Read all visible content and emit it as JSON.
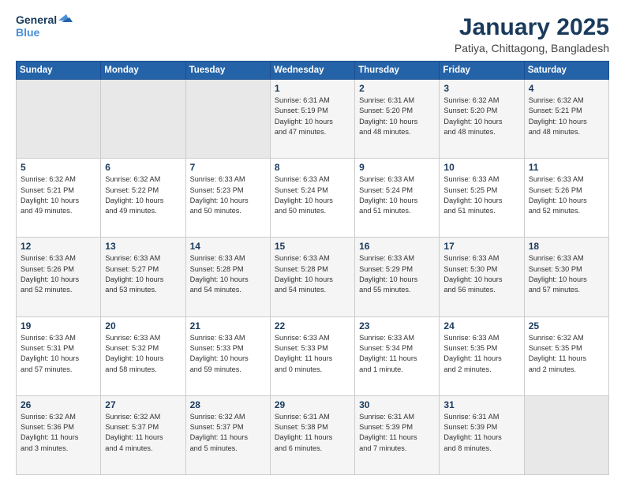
{
  "logo": {
    "line1": "General",
    "line2": "Blue"
  },
  "title": "January 2025",
  "subtitle": "Patiya, Chittagong, Bangladesh",
  "weekdays": [
    "Sunday",
    "Monday",
    "Tuesday",
    "Wednesday",
    "Thursday",
    "Friday",
    "Saturday"
  ],
  "weeks": [
    [
      {
        "day": "",
        "info": ""
      },
      {
        "day": "",
        "info": ""
      },
      {
        "day": "",
        "info": ""
      },
      {
        "day": "1",
        "info": "Sunrise: 6:31 AM\nSunset: 5:19 PM\nDaylight: 10 hours\nand 47 minutes."
      },
      {
        "day": "2",
        "info": "Sunrise: 6:31 AM\nSunset: 5:20 PM\nDaylight: 10 hours\nand 48 minutes."
      },
      {
        "day": "3",
        "info": "Sunrise: 6:32 AM\nSunset: 5:20 PM\nDaylight: 10 hours\nand 48 minutes."
      },
      {
        "day": "4",
        "info": "Sunrise: 6:32 AM\nSunset: 5:21 PM\nDaylight: 10 hours\nand 48 minutes."
      }
    ],
    [
      {
        "day": "5",
        "info": "Sunrise: 6:32 AM\nSunset: 5:21 PM\nDaylight: 10 hours\nand 49 minutes."
      },
      {
        "day": "6",
        "info": "Sunrise: 6:32 AM\nSunset: 5:22 PM\nDaylight: 10 hours\nand 49 minutes."
      },
      {
        "day": "7",
        "info": "Sunrise: 6:33 AM\nSunset: 5:23 PM\nDaylight: 10 hours\nand 50 minutes."
      },
      {
        "day": "8",
        "info": "Sunrise: 6:33 AM\nSunset: 5:24 PM\nDaylight: 10 hours\nand 50 minutes."
      },
      {
        "day": "9",
        "info": "Sunrise: 6:33 AM\nSunset: 5:24 PM\nDaylight: 10 hours\nand 51 minutes."
      },
      {
        "day": "10",
        "info": "Sunrise: 6:33 AM\nSunset: 5:25 PM\nDaylight: 10 hours\nand 51 minutes."
      },
      {
        "day": "11",
        "info": "Sunrise: 6:33 AM\nSunset: 5:26 PM\nDaylight: 10 hours\nand 52 minutes."
      }
    ],
    [
      {
        "day": "12",
        "info": "Sunrise: 6:33 AM\nSunset: 5:26 PM\nDaylight: 10 hours\nand 52 minutes."
      },
      {
        "day": "13",
        "info": "Sunrise: 6:33 AM\nSunset: 5:27 PM\nDaylight: 10 hours\nand 53 minutes."
      },
      {
        "day": "14",
        "info": "Sunrise: 6:33 AM\nSunset: 5:28 PM\nDaylight: 10 hours\nand 54 minutes."
      },
      {
        "day": "15",
        "info": "Sunrise: 6:33 AM\nSunset: 5:28 PM\nDaylight: 10 hours\nand 54 minutes."
      },
      {
        "day": "16",
        "info": "Sunrise: 6:33 AM\nSunset: 5:29 PM\nDaylight: 10 hours\nand 55 minutes."
      },
      {
        "day": "17",
        "info": "Sunrise: 6:33 AM\nSunset: 5:30 PM\nDaylight: 10 hours\nand 56 minutes."
      },
      {
        "day": "18",
        "info": "Sunrise: 6:33 AM\nSunset: 5:30 PM\nDaylight: 10 hours\nand 57 minutes."
      }
    ],
    [
      {
        "day": "19",
        "info": "Sunrise: 6:33 AM\nSunset: 5:31 PM\nDaylight: 10 hours\nand 57 minutes."
      },
      {
        "day": "20",
        "info": "Sunrise: 6:33 AM\nSunset: 5:32 PM\nDaylight: 10 hours\nand 58 minutes."
      },
      {
        "day": "21",
        "info": "Sunrise: 6:33 AM\nSunset: 5:33 PM\nDaylight: 10 hours\nand 59 minutes."
      },
      {
        "day": "22",
        "info": "Sunrise: 6:33 AM\nSunset: 5:33 PM\nDaylight: 11 hours\nand 0 minutes."
      },
      {
        "day": "23",
        "info": "Sunrise: 6:33 AM\nSunset: 5:34 PM\nDaylight: 11 hours\nand 1 minute."
      },
      {
        "day": "24",
        "info": "Sunrise: 6:33 AM\nSunset: 5:35 PM\nDaylight: 11 hours\nand 2 minutes."
      },
      {
        "day": "25",
        "info": "Sunrise: 6:32 AM\nSunset: 5:35 PM\nDaylight: 11 hours\nand 2 minutes."
      }
    ],
    [
      {
        "day": "26",
        "info": "Sunrise: 6:32 AM\nSunset: 5:36 PM\nDaylight: 11 hours\nand 3 minutes."
      },
      {
        "day": "27",
        "info": "Sunrise: 6:32 AM\nSunset: 5:37 PM\nDaylight: 11 hours\nand 4 minutes."
      },
      {
        "day": "28",
        "info": "Sunrise: 6:32 AM\nSunset: 5:37 PM\nDaylight: 11 hours\nand 5 minutes."
      },
      {
        "day": "29",
        "info": "Sunrise: 6:31 AM\nSunset: 5:38 PM\nDaylight: 11 hours\nand 6 minutes."
      },
      {
        "day": "30",
        "info": "Sunrise: 6:31 AM\nSunset: 5:39 PM\nDaylight: 11 hours\nand 7 minutes."
      },
      {
        "day": "31",
        "info": "Sunrise: 6:31 AM\nSunset: 5:39 PM\nDaylight: 11 hours\nand 8 minutes."
      },
      {
        "day": "",
        "info": ""
      }
    ]
  ]
}
